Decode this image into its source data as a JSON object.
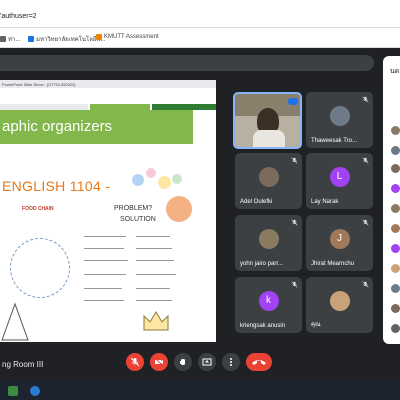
{
  "browser": {
    "url_text": "'authuser=2"
  },
  "bookmarks": [
    {
      "label": "ท่า...",
      "icon_color": "#5f6368"
    },
    {
      "label": "มหาวิทยาลัยเทคโนโลยีพ...",
      "icon_color": "#1a73e8"
    },
    {
      "label": "KMUTT Assessment",
      "icon_color": "#ea8600"
    }
  ],
  "slide": {
    "window_title": "PowerPoint Slide Show - [GTTM-352022]",
    "title": "aphic organizers",
    "course": "ENGLISH 1104 -",
    "doodles": {
      "food_chain": "FOOD CHAIN",
      "problem": "PROBLEM?",
      "solution": "SOLUTION"
    }
  },
  "participants": [
    {
      "name": "",
      "type": "self"
    },
    {
      "name": "Thaweesak Tro...",
      "type": "photo",
      "color": "#6d7a88"
    },
    {
      "name": "Adel Oulefki",
      "type": "photo",
      "color": "#7a6b5a"
    },
    {
      "name": "Lay Narak",
      "type": "letter",
      "letter": "L",
      "color": "#a142f4"
    },
    {
      "name": "yohn jairo parr...",
      "type": "photo",
      "color": "#8a7a60"
    },
    {
      "name": "Jhirat Mearnchu",
      "type": "letter",
      "letter": "J",
      "color": "#a0785a"
    },
    {
      "name": "kriengsak anusin",
      "type": "letter",
      "letter": "k",
      "color": "#a142f4"
    },
    {
      "name": "คุณ",
      "type": "photo",
      "color": "#c9a27a"
    }
  ],
  "panel": {
    "header_fragment": "นด"
  },
  "meeting": {
    "room_fragment": "ng Room III"
  },
  "colors": {
    "meet_bg": "#202124",
    "tile_bg": "#3c4043",
    "end_call": "#ea4335",
    "slide_green": "#82b74b",
    "slide_orange": "#e8781a"
  }
}
